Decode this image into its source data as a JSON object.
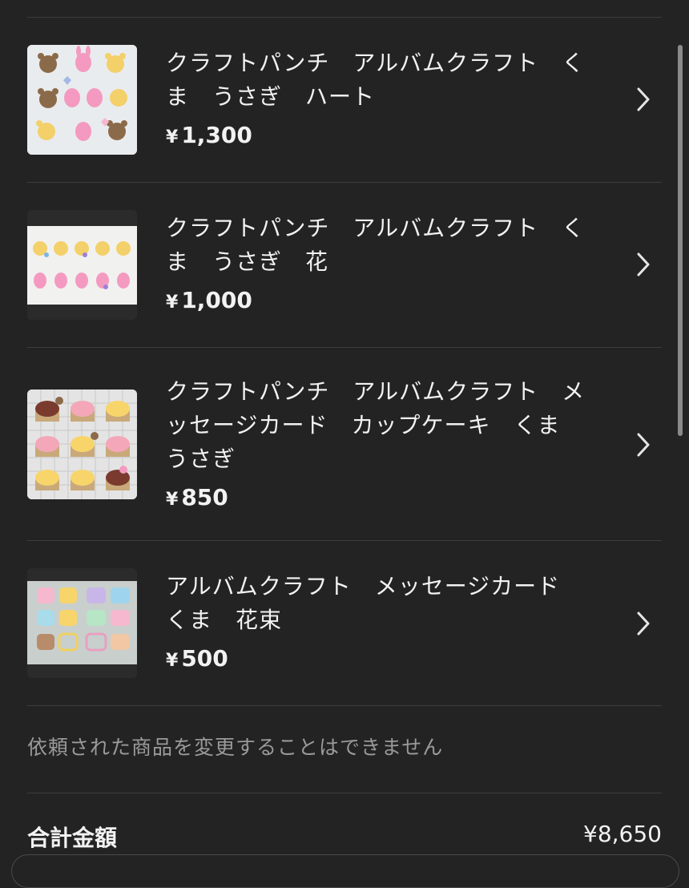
{
  "items": [
    {
      "title": "クラフトパンチ　アルバムクラフト　くま　うさぎ　ハート",
      "price": "1,300",
      "thumb_icon": "bear-bunny-heart-stickers"
    },
    {
      "title": "クラフトパンチ　アルバムクラフト　くま　うさぎ　花",
      "price": "1,000",
      "thumb_icon": "bear-bunny-flower-stickers"
    },
    {
      "title": "クラフトパンチ　アルバムクラフト　メッセージカード　カップケーキ　くま　うさぎ",
      "price": "850",
      "thumb_icon": "cupcake-stickers"
    },
    {
      "title": "アルバムクラフト　メッセージカード　くま　花束",
      "price": "500",
      "thumb_icon": "bear-cards"
    }
  ],
  "currency_symbol": "¥",
  "notice": "依頼された商品を変更することはできません",
  "total": {
    "label": "合計金額",
    "value": "¥8,650"
  },
  "colors": {
    "background": "#232323",
    "divider": "#3d3d3d",
    "text": "#f2f2f2",
    "muted": "#9a9a9a"
  }
}
